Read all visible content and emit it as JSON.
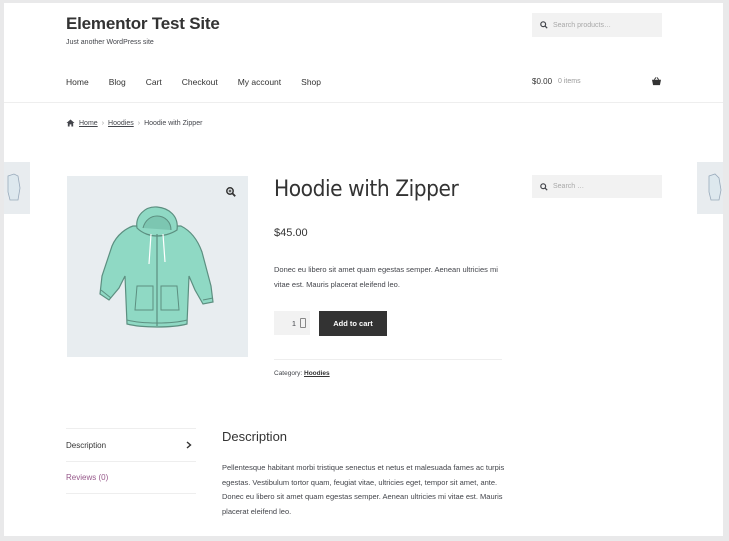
{
  "site": {
    "title": "Elementor Test Site",
    "tagline": "Just another WordPress site"
  },
  "header": {
    "search_placeholder": "Search products…",
    "nav": [
      "Home",
      "Blog",
      "Cart",
      "Checkout",
      "My account",
      "Shop"
    ],
    "cart_amount": "$0.00",
    "cart_count": "0 items"
  },
  "breadcrumb": {
    "home": "Home",
    "category": "Hoodies",
    "current": "Hoodie with Zipper",
    "separator": "›"
  },
  "product": {
    "title": "Hoodie with Zipper",
    "price": "$45.00",
    "short_description": "Donec eu libero sit amet quam egestas semper. Aenean ultricies mi vitae est. Mauris placerat eleifend leo.",
    "quantity": "1",
    "add_to_cart_label": "Add to cart",
    "category_label": "Category:",
    "category_value": "Hoodies",
    "image_icon": "hoodie-image",
    "hoodie_color": "#8fd9c4"
  },
  "sidebar": {
    "search_placeholder": "Search …"
  },
  "tabs": {
    "items": [
      "Description",
      "Reviews (0)"
    ]
  },
  "description": {
    "heading": "Description",
    "body": "Pellentesque habitant morbi tristique senectus et netus et malesuada fames ac turpis egestas. Vestibulum tortor quam, feugiat vitae, ultricies eget, tempor sit amet, ante. Donec eu libero sit amet quam egestas semper. Aenean ultricies mi vitae est. Mauris placerat eleifend leo."
  },
  "colors": {
    "accent": "#96588a",
    "button": "#333333",
    "image_bg": "#e8edf0"
  }
}
